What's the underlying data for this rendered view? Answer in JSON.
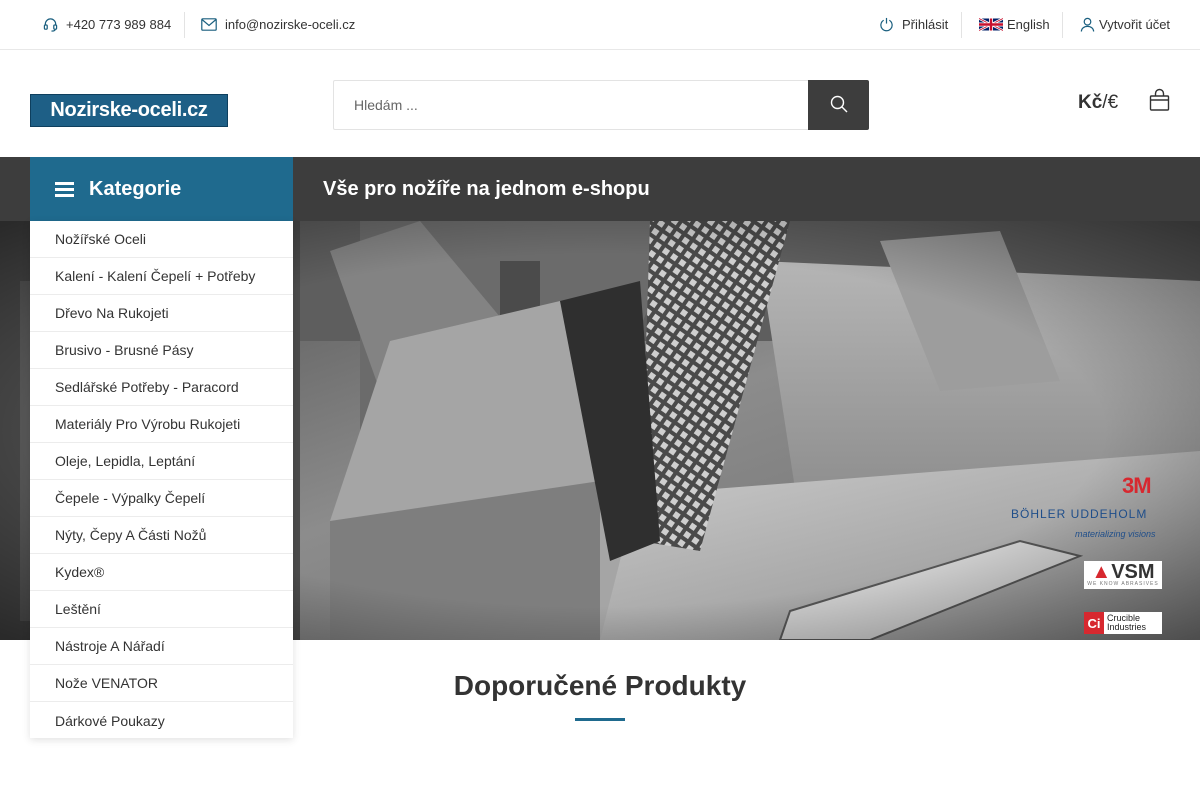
{
  "topbar": {
    "phone": "+420 773 989 884",
    "email": "info@nozirske-oceli.cz",
    "login": "Přihlásit",
    "language": "English",
    "register": "Vytvořit účet"
  },
  "header": {
    "logo_text_a": "Nozirske",
    "logo_text_sep": "-",
    "logo_text_b": "oceli.cz",
    "search_placeholder": "Hledám ...",
    "currency_main": "Kč",
    "currency_sep": "/",
    "currency_alt": "€"
  },
  "nav": {
    "categories_label": "Kategorie",
    "tagline": "Vše pro nožíře na jednom e-shopu"
  },
  "sidebar": {
    "items": [
      {
        "label": "Nožířské Oceli"
      },
      {
        "label": "Kalení - Kalení Čepelí + Potřeby"
      },
      {
        "label": "Dřevo Na Rukojeti"
      },
      {
        "label": "Brusivo - Brusné Pásy"
      },
      {
        "label": "Sedlářské Potřeby - Paracord"
      },
      {
        "label": "Materiály Pro Výrobu Rukojeti"
      },
      {
        "label": "Oleje, Lepidla, Leptání"
      },
      {
        "label": "Čepele - Výpalky Čepelí"
      },
      {
        "label": "Nýty, Čepy A Části Nožů"
      },
      {
        "label": "Kydex®"
      },
      {
        "label": "Leštění"
      },
      {
        "label": "Nástroje A Nářadí"
      },
      {
        "label": "Nože VENATOR"
      },
      {
        "label": "Dárkové Poukazy"
      }
    ]
  },
  "hero": {
    "brands": {
      "mmm": "3M",
      "bohler": "BÖHLER UDDEHOLM",
      "bohler_tagline": "materializing visions",
      "vsm": "VSM",
      "vsm_tagline": "WE KNOW ABRASIVES",
      "crucible_a": "Crucible",
      "crucible_b": "Industries"
    }
  },
  "featured": {
    "title": "Doporučené Produkty"
  },
  "colors": {
    "accent": "#1f6a8e",
    "nav_dark": "#3d3d3d",
    "icon_blue": "#1a5f7f",
    "brand_red": "#d7282f"
  }
}
